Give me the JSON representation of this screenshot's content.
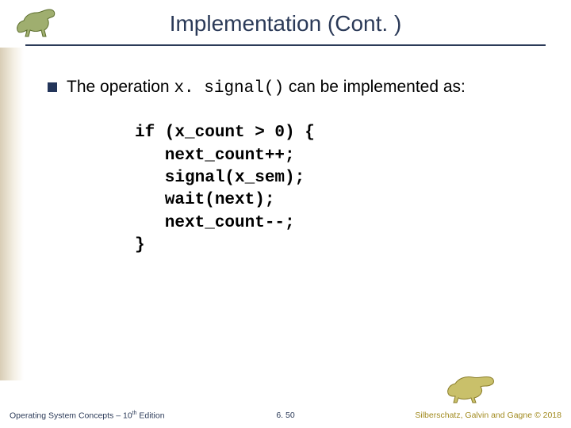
{
  "title": "Implementation (Cont. )",
  "bullet": {
    "pre": "The operation ",
    "code": "x. signal()",
    "post": " can be implemented as:"
  },
  "code": "if (x_count > 0) {\n   next_count++;\n   signal(x_sem);\n   wait(next);\n   next_count--;\n}",
  "footer": {
    "left_prefix": "Operating System Concepts – 10",
    "left_sup": "th",
    "left_suffix": " Edition",
    "center": "6. 50",
    "right": "Silberschatz, Galvin and Gagne © 2018"
  },
  "icons": {
    "top_left": "dinosaur-running-icon",
    "bottom_right": "dinosaur-standing-icon"
  }
}
